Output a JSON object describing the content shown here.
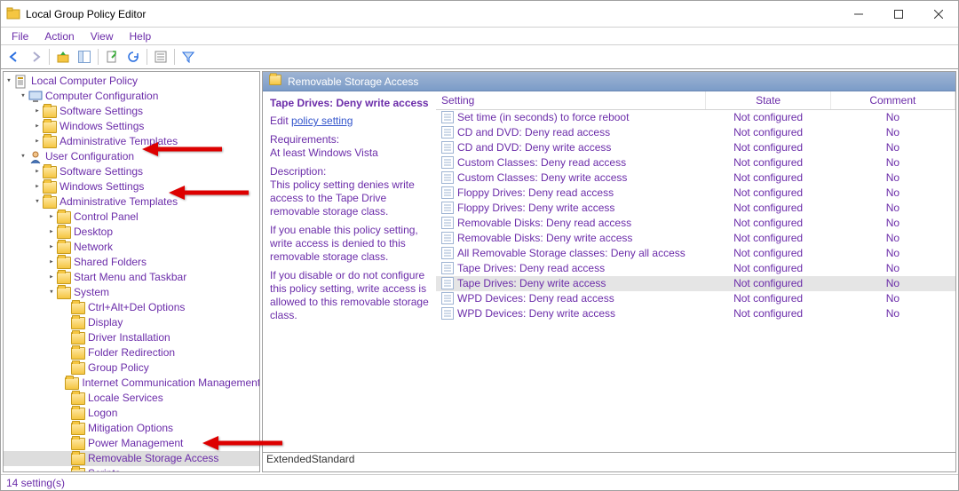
{
  "window": {
    "title": "Local Group Policy Editor"
  },
  "menus": [
    "File",
    "Action",
    "View",
    "Help"
  ],
  "tree": {
    "root": "Local Computer Policy",
    "computer": {
      "label": "Computer Configuration",
      "children": [
        "Software Settings",
        "Windows Settings",
        "Administrative Templates"
      ]
    },
    "user": {
      "label": "User Configuration",
      "software": "Software Settings",
      "windows": "Windows Settings",
      "admin": {
        "label": "Administrative Templates",
        "children": [
          "Control Panel",
          "Desktop",
          "Network",
          "Shared Folders",
          "Start Menu and Taskbar"
        ],
        "system": {
          "label": "System",
          "children": [
            "Ctrl+Alt+Del Options",
            "Display",
            "Driver Installation",
            "Folder Redirection",
            "Group Policy",
            "Internet Communication Management",
            "Locale Services",
            "Logon",
            "Mitigation Options",
            "Power Management",
            "Removable Storage Access",
            "Scripts"
          ]
        }
      }
    }
  },
  "content": {
    "header": "Removable Storage Access",
    "desc": {
      "title": "Tape Drives: Deny write access",
      "edit_label": "Edit ",
      "link": "policy setting",
      "req_label": "Requirements:",
      "req_text": "At least Windows Vista",
      "desc_label": "Description:",
      "desc_text1": "This policy setting denies write access to the Tape Drive removable storage class.",
      "desc_text2": "If you enable this policy setting, write access is denied to this removable storage class.",
      "desc_text3": "If you disable or do not configure this policy setting, write access is allowed to this removable storage class."
    },
    "columns": {
      "setting": "Setting",
      "state": "State",
      "comment": "Comment"
    },
    "rows": [
      {
        "name": "Set time (in seconds) to force reboot",
        "state": "Not configured",
        "comment": "No"
      },
      {
        "name": "CD and DVD: Deny read access",
        "state": "Not configured",
        "comment": "No"
      },
      {
        "name": "CD and DVD: Deny write access",
        "state": "Not configured",
        "comment": "No"
      },
      {
        "name": "Custom Classes: Deny read access",
        "state": "Not configured",
        "comment": "No"
      },
      {
        "name": "Custom Classes: Deny write access",
        "state": "Not configured",
        "comment": "No"
      },
      {
        "name": "Floppy Drives: Deny read access",
        "state": "Not configured",
        "comment": "No"
      },
      {
        "name": "Floppy Drives: Deny write access",
        "state": "Not configured",
        "comment": "No"
      },
      {
        "name": "Removable Disks: Deny read access",
        "state": "Not configured",
        "comment": "No"
      },
      {
        "name": "Removable Disks: Deny write access",
        "state": "Not configured",
        "comment": "No"
      },
      {
        "name": "All Removable Storage classes: Deny all access",
        "state": "Not configured",
        "comment": "No"
      },
      {
        "name": "Tape Drives: Deny read access",
        "state": "Not configured",
        "comment": "No"
      },
      {
        "name": "Tape Drives: Deny write access",
        "state": "Not configured",
        "comment": "No",
        "selected": true
      },
      {
        "name": "WPD Devices: Deny read access",
        "state": "Not configured",
        "comment": "No"
      },
      {
        "name": "WPD Devices: Deny write access",
        "state": "Not configured",
        "comment": "No"
      }
    ],
    "tabs": {
      "extended": "Extended",
      "standard": "Standard"
    }
  },
  "status": "14 setting(s)"
}
